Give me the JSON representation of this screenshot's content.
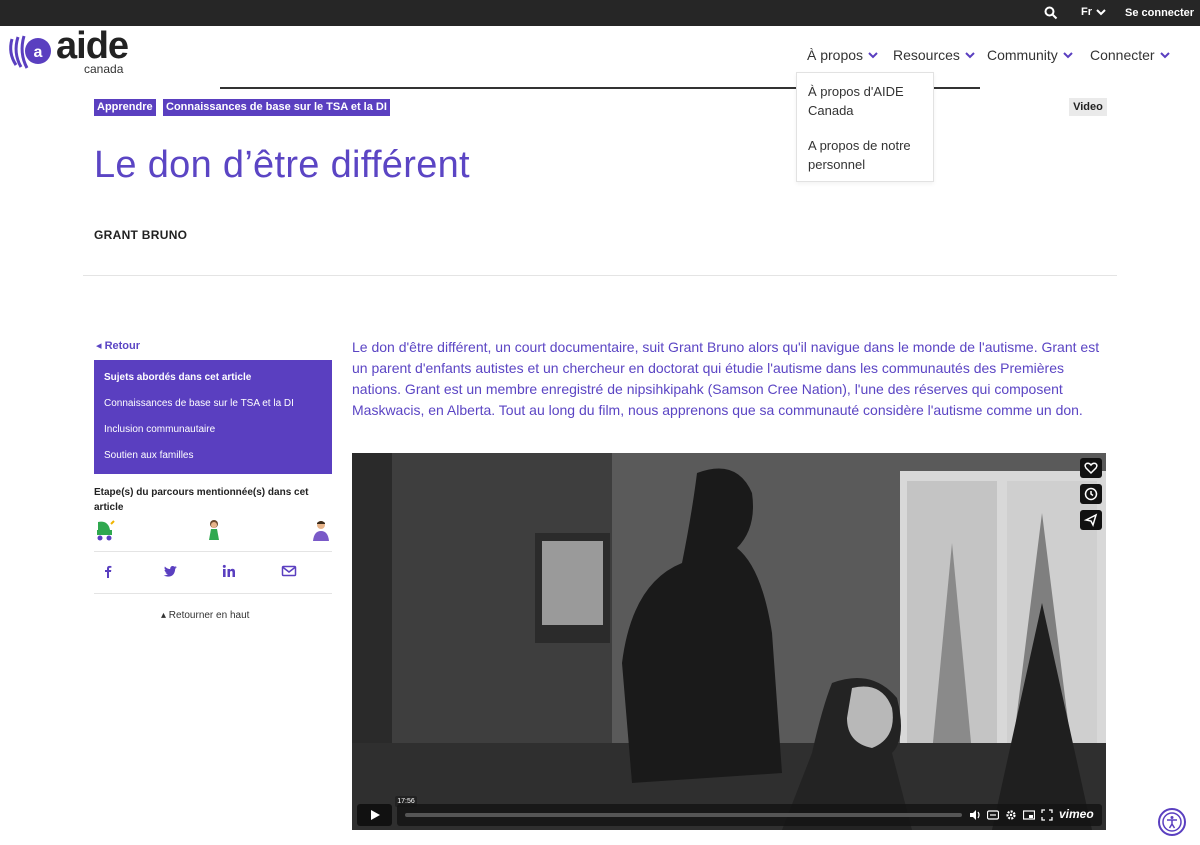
{
  "topbar": {
    "lang": "Fr",
    "login": "Se connecter",
    "icons": [
      "search-icon",
      "chevron-down-icon"
    ]
  },
  "logo": {
    "word": "aide",
    "sub": "canada"
  },
  "nav": {
    "items": [
      {
        "label": "À propos"
      },
      {
        "label": "Resources"
      },
      {
        "label": "Community"
      },
      {
        "label": "Connecter"
      }
    ],
    "dropdown": [
      "À propos d'AIDE Canada",
      "A propos de notre personnel"
    ]
  },
  "breadcrumb": {
    "tag1": "Apprendre",
    "tag2": "Connaissances de base sur le TSA et la DI"
  },
  "content_type": "Video",
  "article": {
    "title": "Le don d’être différent",
    "author": "GRANT BRUNO",
    "intro": "Le don d'être différent, un court documentaire, suit Grant Bruno alors qu'il navigue dans le monde de l'autisme. Grant est un parent d'enfants autistes et un chercheur en doctorat qui étudie l'autisme dans les communautés des Premières nations. Grant est un membre enregistré de nipsihkipahk (Samson Cree Nation), l'une des réserves qui composent Maskwacis, en Alberta. Tout au long du film, nous apprenons que sa communauté considère l'autisme comme un don."
  },
  "sidebar": {
    "back": "◂ Retour",
    "topics_heading": "Sujets abordés dans cet article",
    "topics": [
      "Connaissances de base sur le TSA et la DI",
      "Inclusion communautaire",
      "Soutien aux familles"
    ],
    "steps_heading": "Etape(s) du parcours mentionnée(s) dans cet article",
    "back_to_top": "▴ Retourner en haut",
    "share_icons": [
      "facebook-icon",
      "twitter-icon",
      "linkedin-icon",
      "email-icon"
    ]
  },
  "video": {
    "time": "17:56",
    "brand": "vimeo"
  },
  "colors": {
    "brand": "#5a3fc0",
    "title": "#5b45c4",
    "topbar": "#262626"
  }
}
